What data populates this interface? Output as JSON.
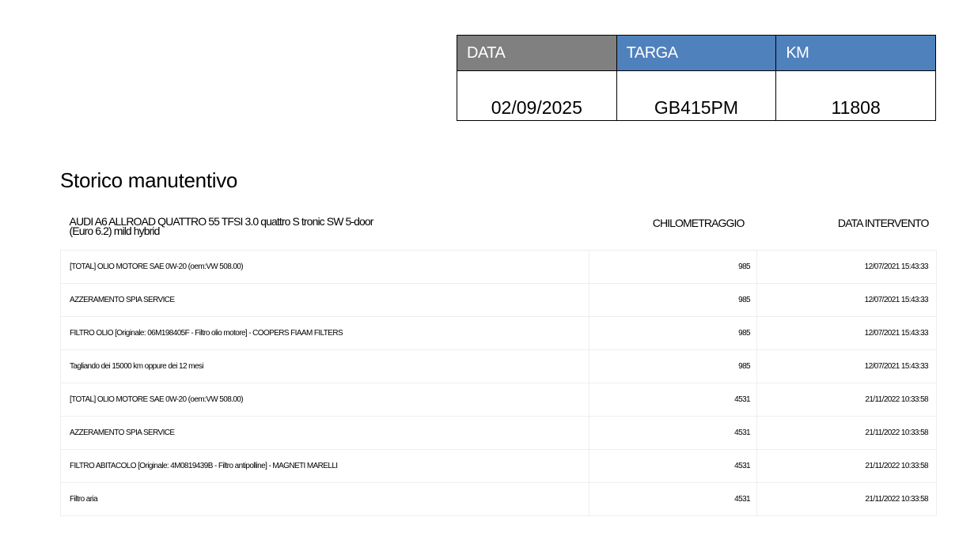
{
  "header": {
    "columns": [
      "DATA",
      "TARGA",
      "KM"
    ],
    "values": [
      "02/09/2025",
      "GB415PM",
      "11808"
    ],
    "colors": {
      "data_header": "#808080",
      "targa_header": "#4f81bd",
      "km_header": "#4f81bd"
    }
  },
  "section_title": "Storico manutentivo",
  "history": {
    "vehicle": "AUDI A6 ALLROAD QUATTRO 55 TFSI 3.0 quattro S tronic SW 5-door (Euro 6.2) mild hybrid",
    "km_header": "CHILOMETRAGGIO",
    "date_header": "DATA INTERVENTO",
    "rows": [
      {
        "description": "[TOTAL] OLIO MOTORE SAE 0W-20 (oem:VW 508.00)",
        "km": "985",
        "date": "12/07/2021 15:43:33"
      },
      {
        "description": "AZZERAMENTO SPIA SERVICE",
        "km": "985",
        "date": "12/07/2021 15:43:33"
      },
      {
        "description": "FILTRO OLIO [Originale: 06M198405F - Filtro olio motore] - COOPERS FIAAM FILTERS",
        "km": "985",
        "date": "12/07/2021 15:43:33"
      },
      {
        "description": "Tagliando dei 15000 km oppure dei 12 mesi",
        "km": "985",
        "date": "12/07/2021 15:43:33"
      },
      {
        "description": "[TOTAL] OLIO MOTORE SAE 0W-20 (oem:VW 508.00)",
        "km": "4531",
        "date": "21/11/2022 10:33:58"
      },
      {
        "description": "AZZERAMENTO SPIA SERVICE",
        "km": "4531",
        "date": "21/11/2022 10:33:58"
      },
      {
        "description": "FILTRO ABITACOLO [Originale: 4M0819439B - Filtro antipolline] - MAGNETI MARELLI",
        "km": "4531",
        "date": "21/11/2022 10:33:58"
      },
      {
        "description": "Filtro aria",
        "km": "4531",
        "date": "21/11/2022 10:33:58"
      }
    ]
  }
}
